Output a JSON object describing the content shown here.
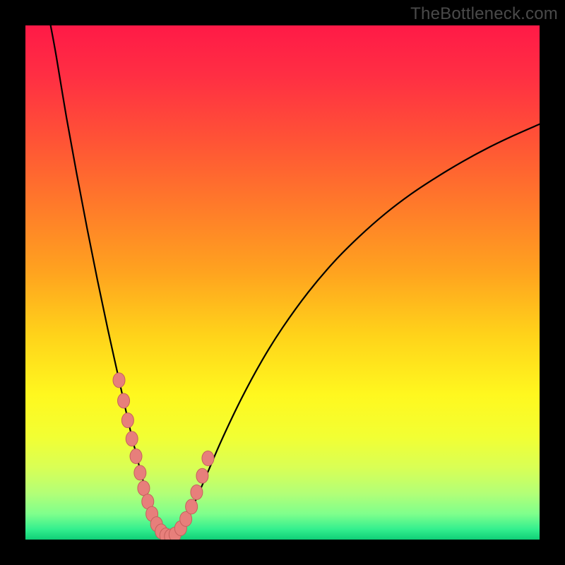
{
  "watermark": "TheBottleneck.com",
  "colors": {
    "frame": "#000000",
    "curve": "#000000",
    "marker_fill": "#e77f7b",
    "marker_stroke": "#c5605c",
    "gradient_stops": [
      {
        "offset": 0.0,
        "color": "#ff1a47"
      },
      {
        "offset": 0.1,
        "color": "#ff2f43"
      },
      {
        "offset": 0.22,
        "color": "#ff5236"
      },
      {
        "offset": 0.35,
        "color": "#ff7a2a"
      },
      {
        "offset": 0.48,
        "color": "#ffa31f"
      },
      {
        "offset": 0.6,
        "color": "#ffd21a"
      },
      {
        "offset": 0.72,
        "color": "#fff81f"
      },
      {
        "offset": 0.8,
        "color": "#f2ff33"
      },
      {
        "offset": 0.86,
        "color": "#d9ff55"
      },
      {
        "offset": 0.91,
        "color": "#b3ff77"
      },
      {
        "offset": 0.95,
        "color": "#7fff8c"
      },
      {
        "offset": 0.98,
        "color": "#33ef8e"
      },
      {
        "offset": 1.0,
        "color": "#0fcf77"
      }
    ]
  },
  "chart_data": {
    "type": "line",
    "title": "",
    "xlabel": "",
    "ylabel": "",
    "xlim": [
      0,
      100
    ],
    "ylim": [
      0,
      100
    ],
    "note": "V-shaped bottleneck curve; minimum near x≈26; y read as percentage (0 = bottom/green, 100 = top/red).",
    "series": [
      {
        "name": "curve",
        "x": [
          4.9,
          6,
          8,
          10,
          12,
          14,
          16,
          18,
          20,
          21,
          22,
          23,
          24,
          25,
          26,
          27,
          28,
          29,
          30,
          31,
          32,
          33,
          35,
          38,
          42,
          46,
          50,
          55,
          60,
          65,
          70,
          75,
          80,
          85,
          90,
          95,
          100
        ],
        "y": [
          100,
          94,
          82,
          71,
          60.5,
          50.5,
          41,
          32,
          23,
          18.8,
          14.8,
          11,
          7.6,
          4.6,
          2.4,
          1,
          0.4,
          0.6,
          1.6,
          3.2,
          5.2,
          7.4,
          12,
          19,
          27.4,
          34.8,
          41.2,
          48.1,
          54,
          59,
          63.4,
          67.2,
          70.5,
          73.5,
          76.2,
          78.6,
          80.8
        ]
      }
    ],
    "markers": {
      "name": "highlighted-points",
      "x": [
        18.2,
        19.1,
        19.9,
        20.7,
        21.5,
        22.3,
        23.0,
        23.8,
        24.6,
        25.5,
        26.4,
        27.3,
        28.2,
        29.1,
        30.2,
        31.2,
        32.3,
        33.3,
        34.4,
        35.5
      ],
      "y": [
        31.0,
        27.0,
        23.2,
        19.6,
        16.2,
        13.0,
        10.0,
        7.4,
        5.0,
        3.0,
        1.6,
        0.8,
        0.6,
        1.0,
        2.2,
        4.0,
        6.4,
        9.2,
        12.4,
        15.8
      ]
    }
  }
}
